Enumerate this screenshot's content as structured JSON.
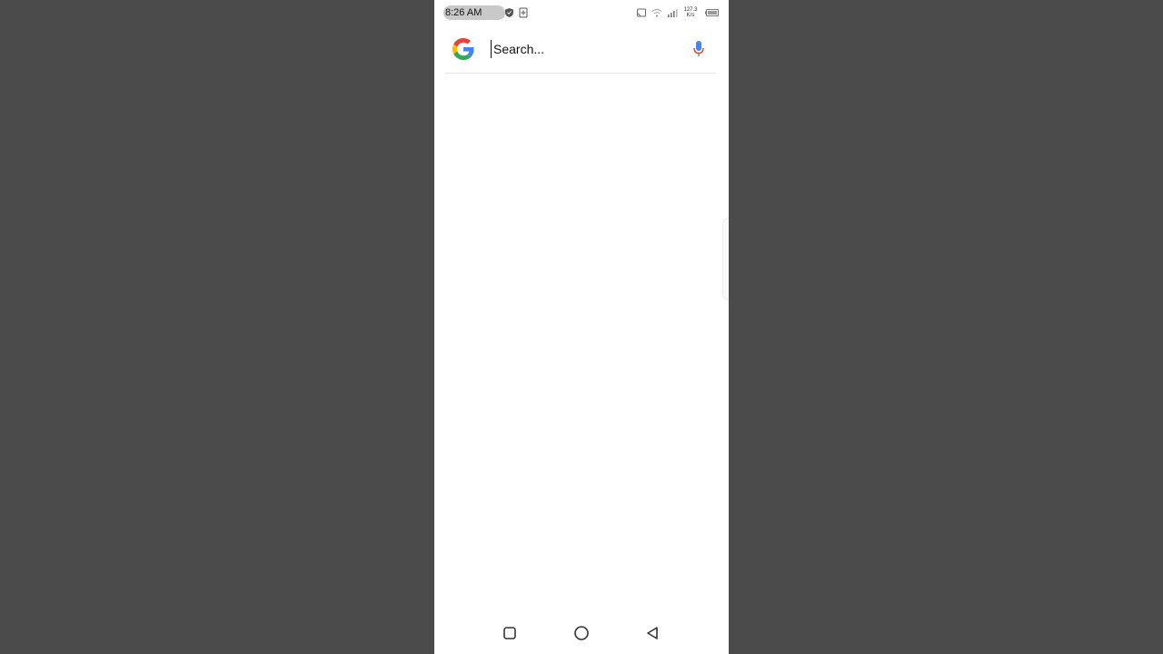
{
  "status_bar": {
    "time": "8:26 AM",
    "net_speed_value": "127.3",
    "net_speed_unit": "K/s",
    "icons_left": [
      "whatsapp-icon",
      "shield-icon",
      "plus-box-icon"
    ],
    "icons_right": [
      "cast-icon",
      "wifi-icon",
      "signal-icon",
      "battery-icon"
    ]
  },
  "search": {
    "placeholder": "Search...",
    "value": "",
    "logo": "google-g-logo",
    "voice_icon": "mic-icon"
  },
  "nav_bar": {
    "buttons": [
      "recents-button",
      "home-button",
      "back-button"
    ]
  },
  "colors": {
    "background": "#4b4b4b",
    "screen": "#ffffff",
    "google_blue": "#4285F4",
    "google_red": "#EA4335",
    "google_yellow": "#FBBC05",
    "google_green": "#34A853"
  }
}
